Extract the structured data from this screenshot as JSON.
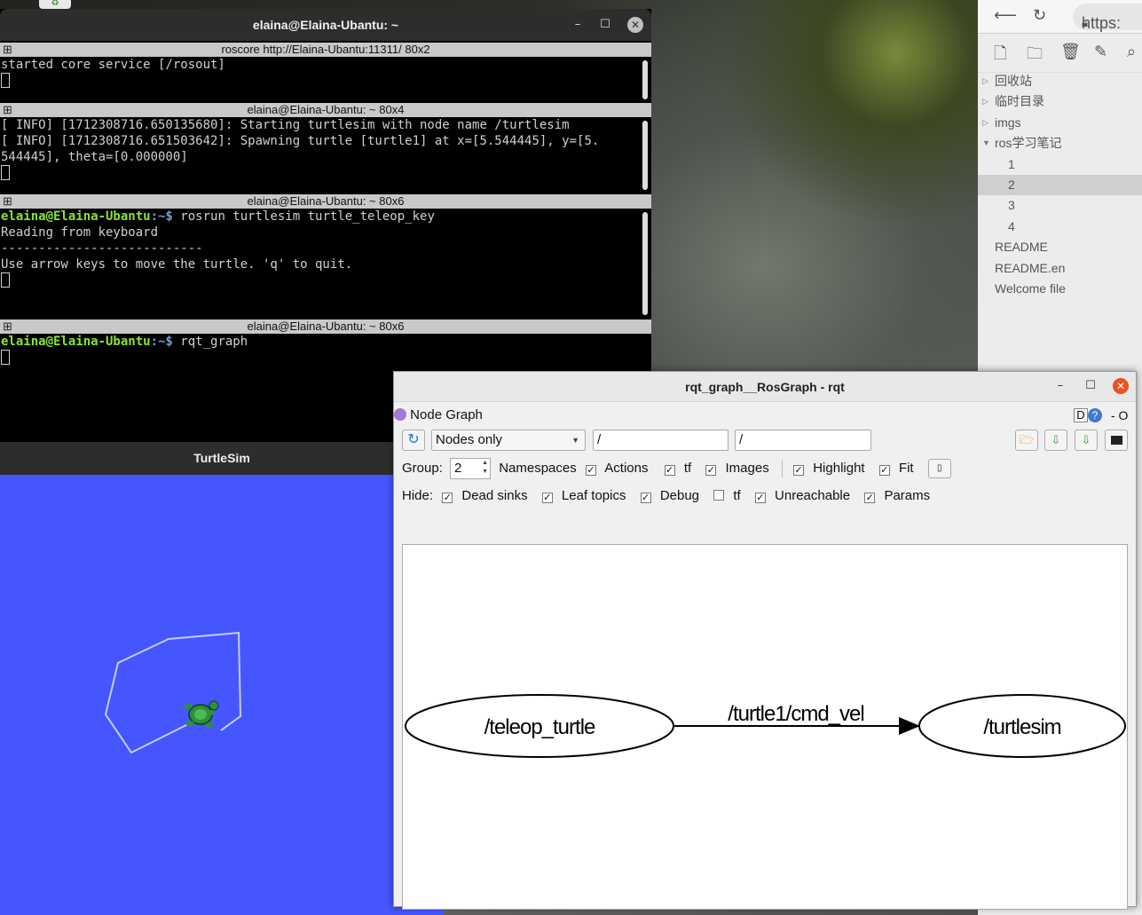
{
  "terminal": {
    "title": "elaina@Elaina-Ubantu: ~",
    "panes": [
      {
        "header": "roscore http://Elaina-Ubantu:11311/ 80x2",
        "lines": [
          "started core service [/rosout]"
        ]
      },
      {
        "header": "elaina@Elaina-Ubantu: ~ 80x4",
        "lines": [
          "[ INFO] [1712308716.650135680]: Starting turtlesim with node name /turtlesim",
          "[ INFO] [1712308716.651503642]: Spawning turtle [turtle1] at x=[5.544445], y=[5.",
          "544445], theta=[0.000000]"
        ]
      },
      {
        "header": "elaina@Elaina-Ubantu: ~ 80x6",
        "prompt_user": "elaina@Elaina-Ubantu",
        "prompt_path": ":~$ ",
        "command": "rosrun turtlesim turtle_teleop_key",
        "lines": [
          "Reading from keyboard",
          "---------------------------",
          "Use arrow keys to move the turtle. 'q' to quit."
        ]
      },
      {
        "header": "elaina@Elaina-Ubantu: ~ 80x6",
        "prompt_user": "elaina@Elaina-Ubantu",
        "prompt_path": ":~$ ",
        "command": "rqt_graph"
      }
    ]
  },
  "turtlesim": {
    "title": "TurtleSim",
    "bg_color": "#4556ff"
  },
  "sidebar": {
    "url": "https:",
    "items": [
      {
        "label": "回收站",
        "arrow": "▷"
      },
      {
        "label": "临时目录",
        "arrow": "▷"
      },
      {
        "label": "imgs",
        "arrow": "▷"
      },
      {
        "label": "ros学习笔记",
        "arrow": "▼"
      },
      {
        "label": "1"
      },
      {
        "label": "2"
      },
      {
        "label": "3"
      },
      {
        "label": "4"
      },
      {
        "label": "README"
      },
      {
        "label": "README.en"
      },
      {
        "label": "Welcome file"
      }
    ]
  },
  "rqt": {
    "title": "rqt_graph__RosGraph - rqt",
    "plugin_title": "Node Graph",
    "dock_label": "D",
    "help_label": "?",
    "dock_controls": "- O",
    "mode_select": "Nodes only",
    "filter1": "/",
    "filter2": "/",
    "group_label": "Group:",
    "group_value": "2",
    "options": [
      {
        "label": "Namespaces",
        "checked": true
      },
      {
        "label": "Actions",
        "checked": true
      },
      {
        "label": "tf",
        "checked": true
      },
      {
        "label": "Images",
        "checked": true
      },
      {
        "label": "Highlight",
        "checked": true
      },
      {
        "label": "Fit",
        "checked": true
      }
    ],
    "hide_label": "Hide:",
    "hide_options": [
      {
        "label": "Dead sinks",
        "checked": true
      },
      {
        "label": "Leaf topics",
        "checked": true
      },
      {
        "label": "Debug",
        "checked": true
      },
      {
        "label": "tf",
        "checked": false
      },
      {
        "label": "Unreachable",
        "checked": true
      },
      {
        "label": "Params",
        "checked": true
      }
    ],
    "graph": {
      "source_node": "/teleop_turtle",
      "topic": "/turtle1/cmd_vel",
      "target_node": "/turtlesim"
    }
  }
}
